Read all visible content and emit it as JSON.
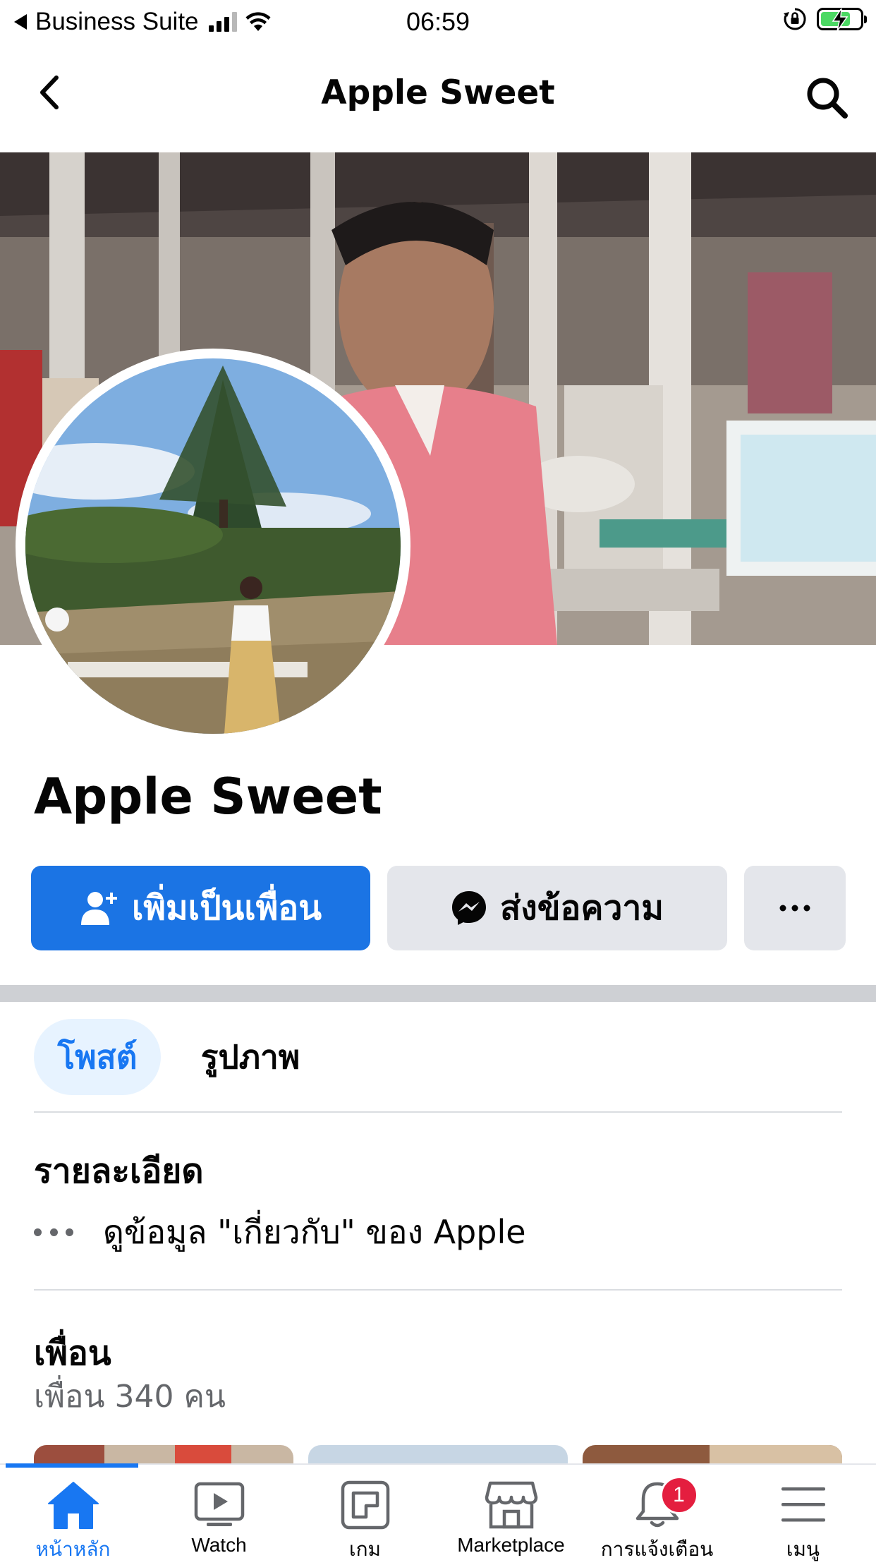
{
  "status_bar": {
    "carrier": "Business Suite",
    "time": "06:59",
    "battery_level": 0.75,
    "battery_color": "#4cd964"
  },
  "nav": {
    "title": "Apple Sweet",
    "back_icon": "chevron-left-icon",
    "search_icon": "search-icon"
  },
  "profile": {
    "name": "Apple Sweet",
    "add_friend_label": "เพิ่มเป็นเพื่อน",
    "message_label": "ส่งข้อความ",
    "more_icon": "more-icon"
  },
  "tabs": [
    {
      "label": "โพสต์",
      "active": true
    },
    {
      "label": "รูปภาพ",
      "active": false
    }
  ],
  "details": {
    "title": "รายละเอียด",
    "about_text": "ดูข้อมูล \"เกี่ยวกับ\" ของ Apple"
  },
  "friends": {
    "title": "เพื่อน",
    "count_text": "เพื่อน 340 คน"
  },
  "tabbar": {
    "items": [
      {
        "label": "หน้าหลัก",
        "icon": "home-icon",
        "active": true
      },
      {
        "label": "Watch",
        "icon": "watch-icon",
        "active": false
      },
      {
        "label": "เกม",
        "icon": "gaming-icon",
        "active": false
      },
      {
        "label": "Marketplace",
        "icon": "marketplace-icon",
        "active": false
      },
      {
        "label": "การแจ้งเตือน",
        "icon": "bell-icon",
        "active": false,
        "badge": "1"
      },
      {
        "label": "เมนู",
        "icon": "menu-icon",
        "active": false
      }
    ]
  },
  "colors": {
    "accent": "#1877f2",
    "button_primary": "#1b74e4",
    "button_secondary": "#e4e6eb",
    "badge": "#e41e3f"
  }
}
